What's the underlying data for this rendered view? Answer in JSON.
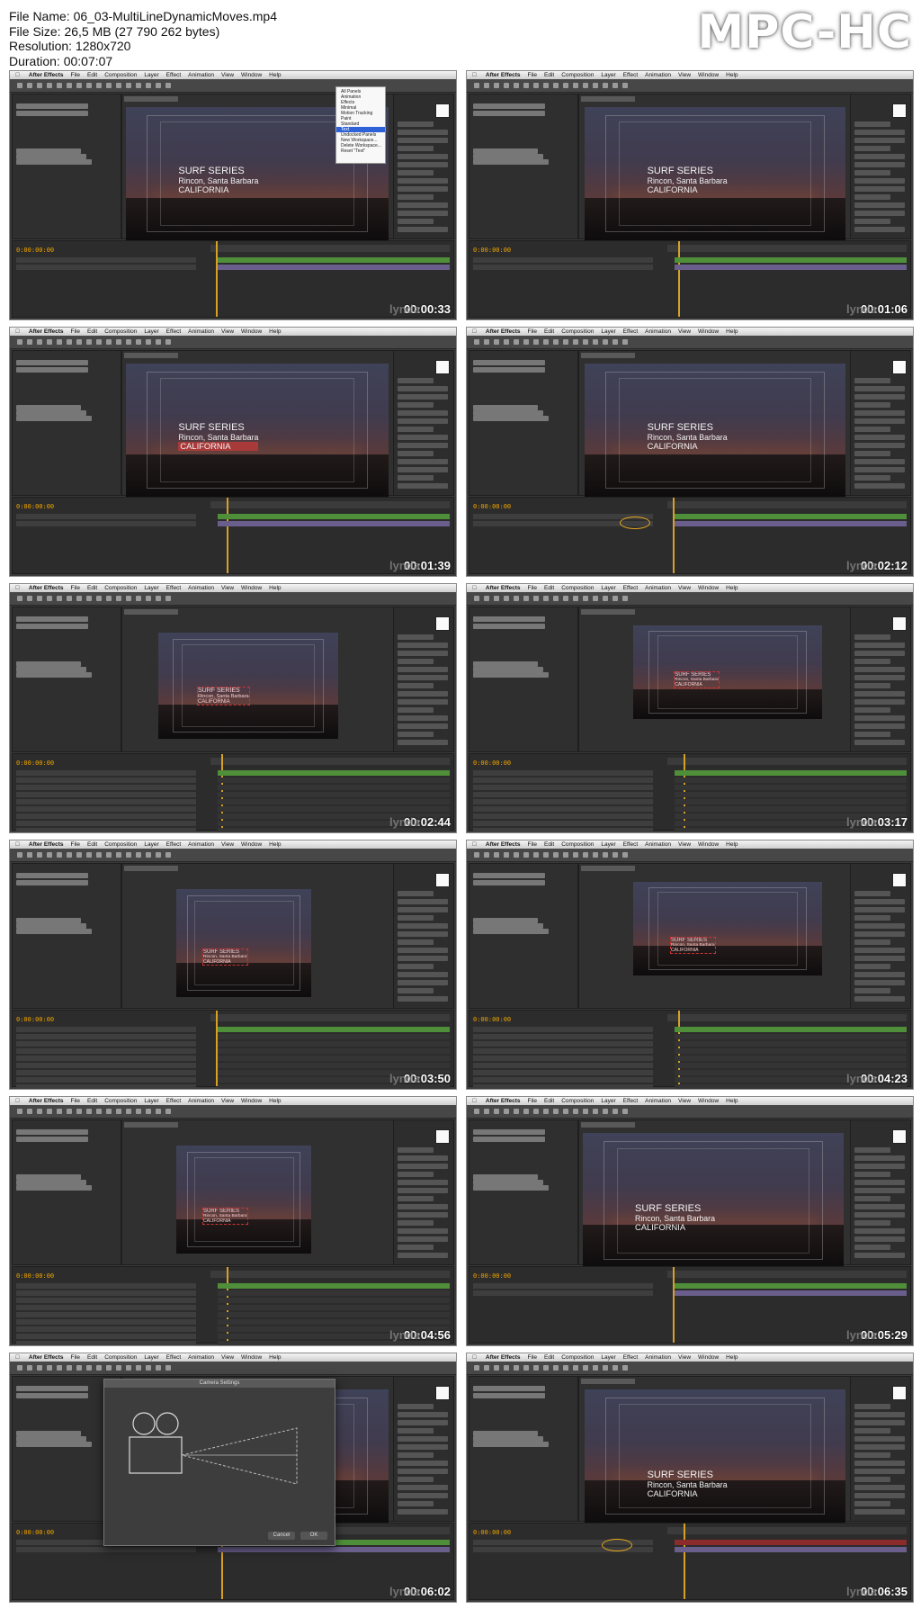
{
  "header": {
    "file_name_line": "File Name: 06_03-MultiLineDynamicMoves.mp4",
    "file_size_line": "File Size: 26,5 MB (27 790 262 bytes)",
    "resolution_line": "Resolution: 1280x720",
    "duration_line": "Duration: 00:07:07",
    "player_logo": "MPC-HC"
  },
  "app": {
    "menu": [
      "After Effects",
      "File",
      "Edit",
      "Composition",
      "Layer",
      "Effect",
      "Animation",
      "View",
      "Window",
      "Help"
    ],
    "watermark": "lynda"
  },
  "workspace_menu": [
    "All Panels",
    "Animation",
    "Effects",
    "Minimal",
    "Motion Tracking",
    "Paint",
    "Standard",
    "Text",
    "Undocked Panels",
    "New Workspace...",
    "Delete Workspace...",
    "Reset \"Text\""
  ],
  "camera_dialog": {
    "title": "Camera Settings",
    "ok": "OK",
    "cancel": "Cancel"
  },
  "thumbnails": [
    {
      "timestamp": "00:00:33",
      "text": {
        "line1": "SURF SERIES",
        "line2": "Rincon, Santa Barbara",
        "line3": "CALIFORNIA"
      }
    },
    {
      "timestamp": "00:01:06",
      "text": {
        "line1": "SURF SERIES",
        "line2": "Rincon, Santa Barbara",
        "line3": "CALIFORNIA"
      }
    },
    {
      "timestamp": "00:01:39",
      "text": {
        "line1": "SURF SERIES",
        "line2": "Rincon, Santa Barbara",
        "line3": "CALIFORNIA"
      }
    },
    {
      "timestamp": "00:02:12",
      "text": {
        "line1": "SURF SERIES",
        "line2": "Rincon, Santa Barbara",
        "line3": "CALIFORNIA"
      }
    },
    {
      "timestamp": "00:02:44",
      "text": {
        "line1": "SURF SERIES",
        "line2": "Rincon, Santa Barbara",
        "line3": "CALIFORNIA"
      }
    },
    {
      "timestamp": "00:03:17",
      "text": {
        "line1": "SURF SERIES",
        "line2": "Rincon, Santa Barbara",
        "line3": "CALIFORNIA"
      }
    },
    {
      "timestamp": "00:03:50",
      "text": {
        "line1": "SURF SERIES",
        "line2": "Rincon, Santa Barbara",
        "line3": "CALIFORNIA"
      }
    },
    {
      "timestamp": "00:04:23",
      "text": {
        "line1": "SURF SERIES",
        "line2": "Rincon, Santa Barbara",
        "line3": "CALIFORNIA"
      }
    },
    {
      "timestamp": "00:04:56",
      "text": {
        "line1": "SURF SERIES",
        "line2": "Rincon, Santa Barbara",
        "line3": "CALIFORNIA"
      }
    },
    {
      "timestamp": "00:05:29",
      "text": {
        "line1": "SURF SERIES",
        "line2": "Rincon, Santa Barbara",
        "line3": "CALIFORNIA"
      }
    },
    {
      "timestamp": "00:06:02",
      "text": {
        "line1": "",
        "line2": "",
        "line3": ""
      }
    },
    {
      "timestamp": "00:06:35",
      "text": {
        "line1": "SURF SERIES",
        "line2": "Rincon, Santa Barbara",
        "line3": "CALIFORNIA"
      }
    }
  ],
  "colors": {
    "accent": "#d7a126",
    "timecode": "#f0a500",
    "timeline_green": "#4f8f3a",
    "timeline_red": "#8b2b2b",
    "timeline_purple": "#6a5f8c"
  }
}
